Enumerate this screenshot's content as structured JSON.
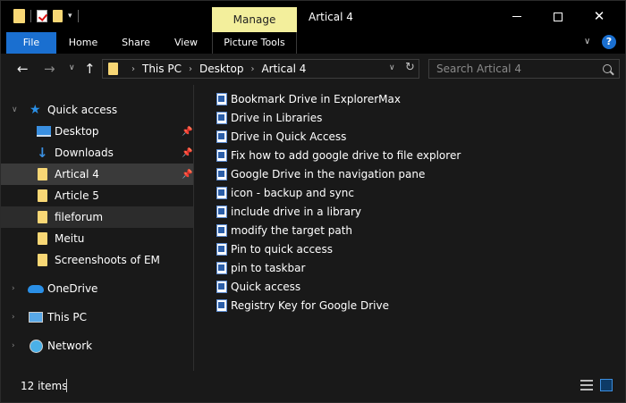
{
  "window": {
    "title": "Artical 4",
    "manage_tab": "Manage"
  },
  "ribbon": {
    "tabs": [
      "File",
      "Home",
      "Share",
      "View",
      "Picture Tools"
    ]
  },
  "address": {
    "crumbs": [
      "This PC",
      "Desktop",
      "Artical 4"
    ]
  },
  "search": {
    "placeholder": "Search Artical 4"
  },
  "nav": {
    "quick_access": "Quick access",
    "items": [
      {
        "label": "Desktop",
        "icon": "desktop-icon",
        "pinned": true
      },
      {
        "label": "Downloads",
        "icon": "downloads-icon",
        "pinned": true
      },
      {
        "label": "Artical 4",
        "icon": "folder-icon",
        "pinned": true,
        "selected": true
      },
      {
        "label": "Article 5",
        "icon": "folder-icon",
        "pinned": false
      },
      {
        "label": "fileforum",
        "icon": "folder-icon",
        "pinned": false,
        "hover": true
      },
      {
        "label": "Meitu",
        "icon": "folder-icon",
        "pinned": false
      },
      {
        "label": "Screenshoots of EM",
        "icon": "folder-icon",
        "pinned": false
      }
    ],
    "onedrive": "OneDrive",
    "this_pc": "This PC",
    "network": "Network"
  },
  "files": [
    "Bookmark Drive in ExplorerMax",
    "Drive in Libraries",
    "Drive in Quick Access",
    "Fix how to add google drive to file explorer",
    "Google Drive in the navigation pane",
    "icon - backup and sync",
    "include drive in a library",
    "modify the target path",
    "Pin to quick access",
    "pin to taskbar",
    "Quick access",
    "Registry Key for Google Drive"
  ],
  "status": {
    "item_count": "12 items"
  },
  "colors": {
    "accent": "#1a6fd0",
    "manage_tab": "#f3ef9c",
    "folder": "#f8d775",
    "background": "#191919"
  }
}
